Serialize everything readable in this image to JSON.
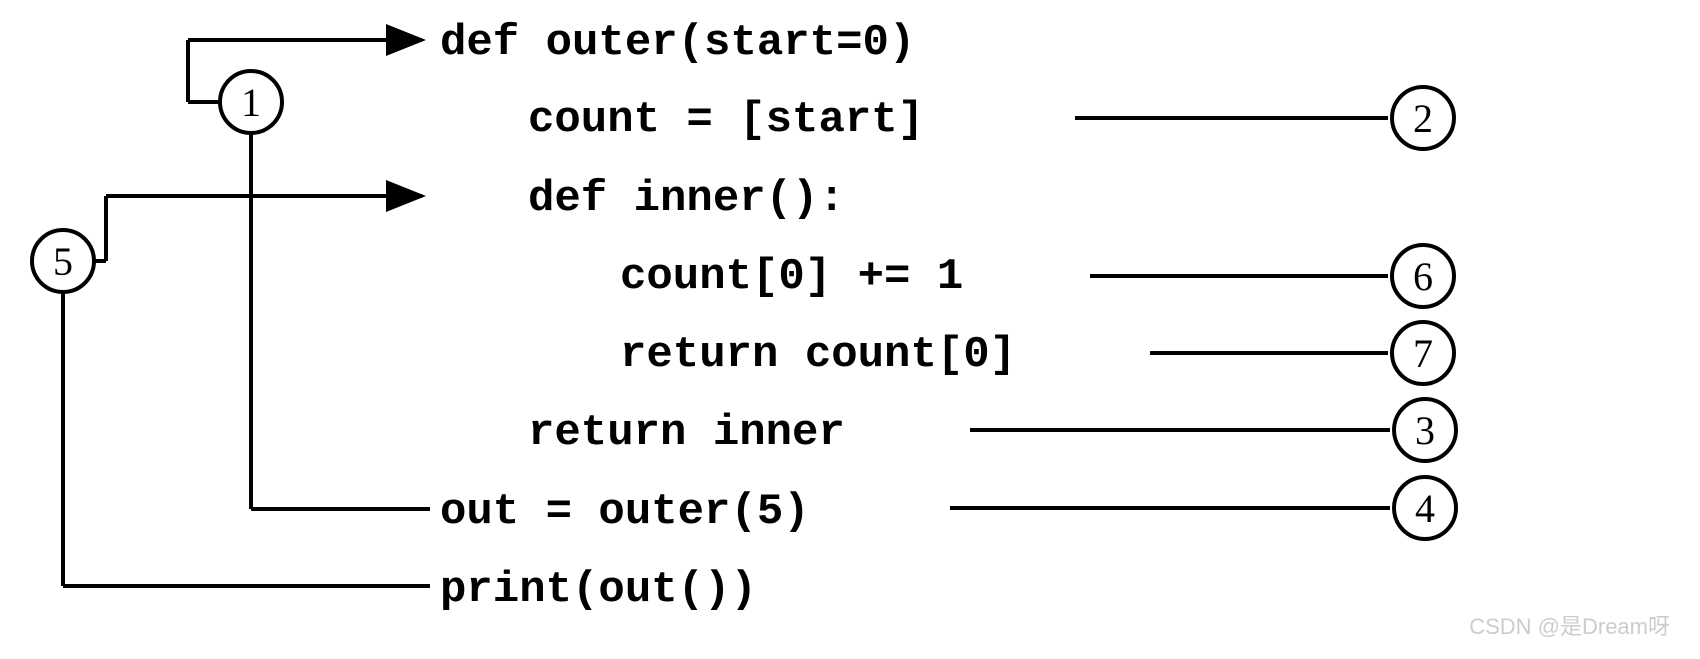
{
  "code": {
    "line1": "def outer(start=0)",
    "line2": "count = [start]",
    "line3": "def inner():",
    "line4": "count[0] += 1",
    "line5": "return count[0]",
    "line6": "return inner",
    "line7": "out = outer(5)",
    "line8": "print(out())"
  },
  "steps": {
    "s1": "1",
    "s2": "2",
    "s3": "3",
    "s4": "4",
    "s5": "5",
    "s6": "6",
    "s7": "7"
  },
  "watermark": "CSDN @是Dream呀"
}
